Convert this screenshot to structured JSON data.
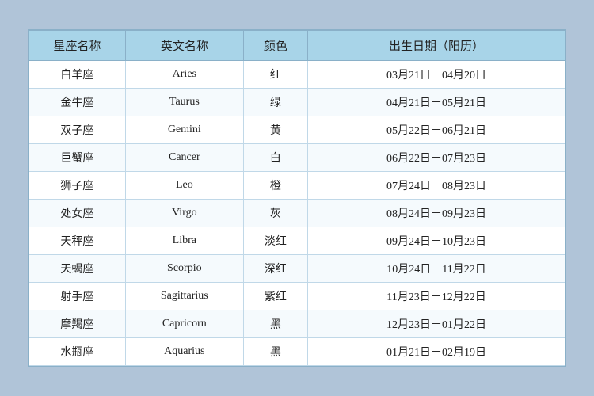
{
  "table": {
    "headers": [
      "星座名称",
      "英文名称",
      "颜色",
      "出生日期（阳历）"
    ],
    "rows": [
      {
        "chinese": "白羊座",
        "english": "Aries",
        "color": "红",
        "date": "03月21日－04月20日"
      },
      {
        "chinese": "金牛座",
        "english": "Taurus",
        "color": "绿",
        "date": "04月21日－05月21日"
      },
      {
        "chinese": "双子座",
        "english": "Gemini",
        "color": "黄",
        "date": "05月22日－06月21日"
      },
      {
        "chinese": "巨蟹座",
        "english": "Cancer",
        "color": "白",
        "date": "06月22日－07月23日"
      },
      {
        "chinese": "狮子座",
        "english": "Leo",
        "color": "橙",
        "date": "07月24日－08月23日"
      },
      {
        "chinese": "处女座",
        "english": "Virgo",
        "color": "灰",
        "date": "08月24日－09月23日"
      },
      {
        "chinese": "天秤座",
        "english": "Libra",
        "color": "淡红",
        "date": "09月24日－10月23日"
      },
      {
        "chinese": "天蝎座",
        "english": "Scorpio",
        "color": "深红",
        "date": "10月24日－11月22日"
      },
      {
        "chinese": "射手座",
        "english": "Sagittarius",
        "color": "紫红",
        "date": "11月23日－12月22日"
      },
      {
        "chinese": "摩羯座",
        "english": "Capricorn",
        "color": "黑",
        "date": "12月23日－01月22日"
      },
      {
        "chinese": "水瓶座",
        "english": "Aquarius",
        "color": "黑",
        "date": "01月21日－02月19日"
      }
    ]
  }
}
